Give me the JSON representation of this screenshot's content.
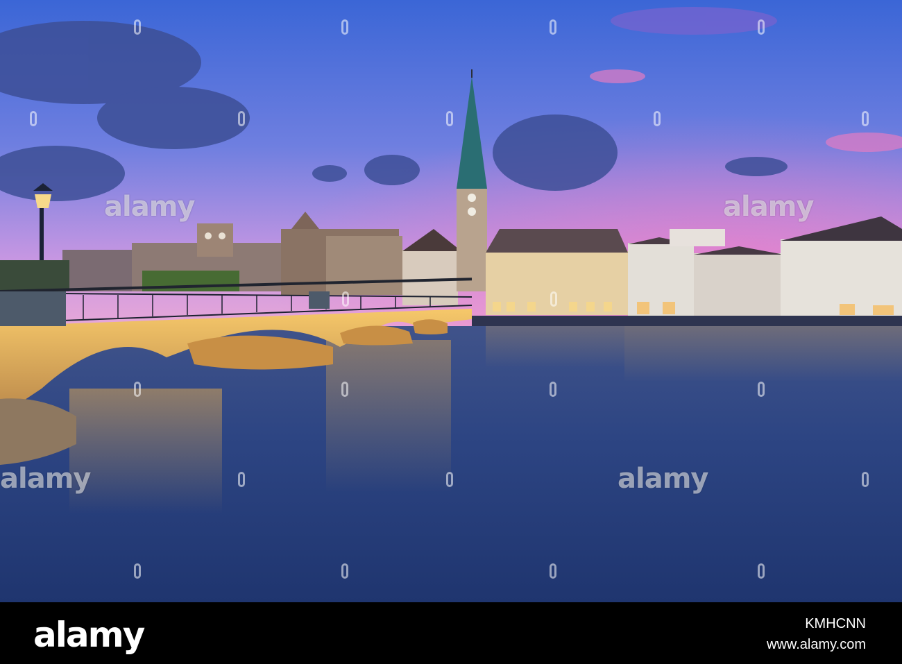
{
  "watermark": {
    "text": "alamy"
  },
  "footer": {
    "logo": "alamy",
    "image_id": "KMHCNN",
    "site": "www.alamy.com"
  },
  "colors": {
    "sky_top": "#4a6bd1",
    "sky_pink": "#e88ac9",
    "water": "#2a3f78",
    "bridge_lights": "#f4b24a"
  }
}
